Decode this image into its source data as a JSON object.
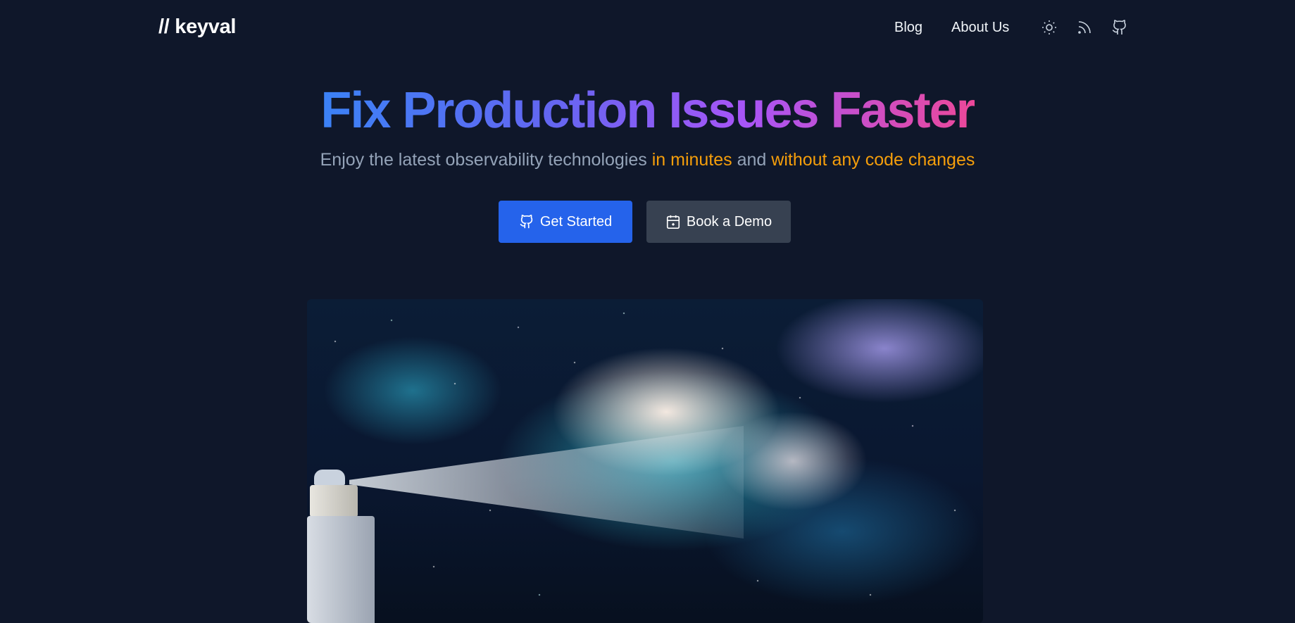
{
  "nav": {
    "logo": "// keyval",
    "links": [
      {
        "label": "Blog"
      },
      {
        "label": "About Us"
      }
    ],
    "icons": [
      "sun-icon",
      "rss-icon",
      "github-icon"
    ]
  },
  "hero": {
    "title": "Fix Production Issues Faster",
    "subtitle": {
      "part1": "Enjoy the latest observability technologies ",
      "highlight1": "in minutes",
      "part2": " and ",
      "highlight2": "without any code changes"
    },
    "buttons": {
      "primary_label": "Get Started",
      "secondary_label": "Book a Demo"
    }
  },
  "colors": {
    "background": "#0f172a",
    "primary_button": "#2563eb",
    "secondary_button": "#374151",
    "highlight": "#f59e0b",
    "title_gradient": [
      "#3b82f6",
      "#6366f1",
      "#a855f7",
      "#ec4899"
    ]
  }
}
